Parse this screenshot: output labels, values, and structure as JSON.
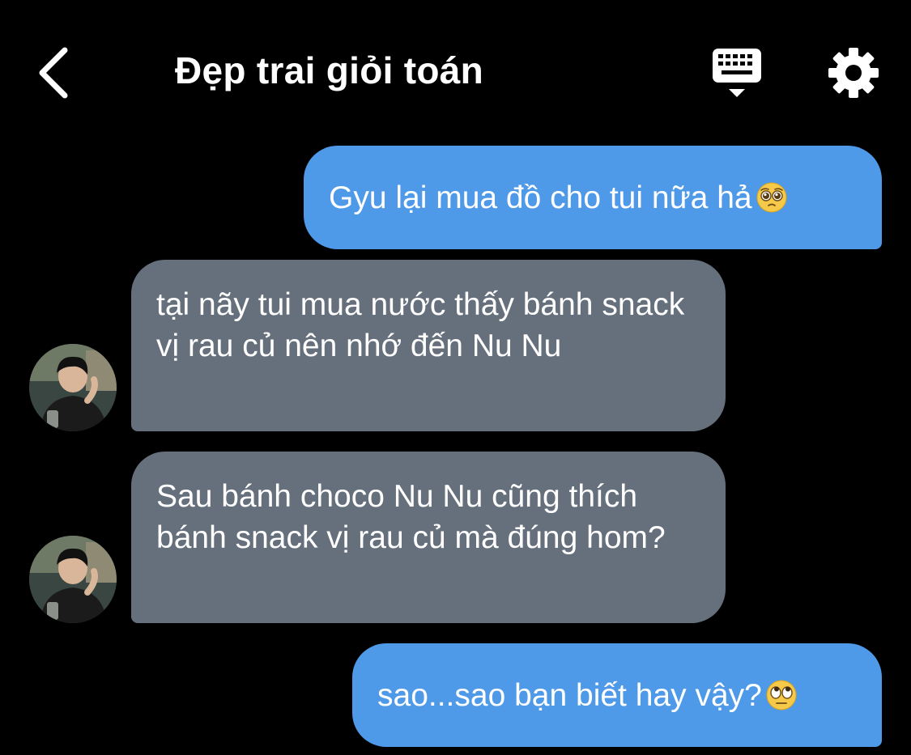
{
  "header": {
    "title": "Đẹp trai giỏi toán",
    "back_icon": "chevron-left-icon",
    "keyboard_icon": "keyboard-icon",
    "settings_icon": "gear-icon"
  },
  "colors": {
    "background": "#000000",
    "outgoing_bubble": "#4f9ae8",
    "incoming_bubble": "#66707d"
  },
  "messages": [
    {
      "sender": "me",
      "text": "Gyu lại mua đồ cho tui nữa hả",
      "emoji": "pleading-face-emoji"
    },
    {
      "sender": "them",
      "text": "tại nãy tui mua nước thấy bánh snack vị rau củ nên nhớ đến Nu Nu"
    },
    {
      "sender": "them",
      "text": "Sau bánh choco Nu Nu cũng thích bánh snack vị rau củ mà đúng hom?"
    },
    {
      "sender": "me",
      "text": "sao...sao bạn biết hay vậy?",
      "emoji": "eye-roll-face-emoji"
    }
  ]
}
